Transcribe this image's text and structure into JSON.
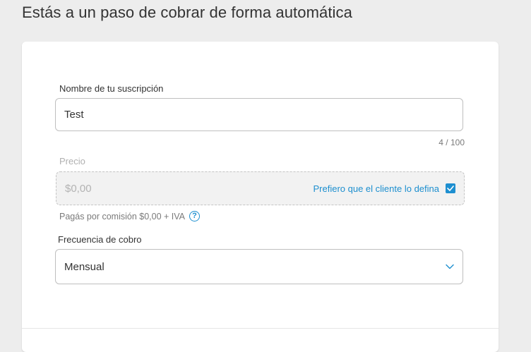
{
  "page": {
    "title": "Estás a un paso de cobrar de forma automática"
  },
  "form": {
    "name": {
      "label": "Nombre de tu suscripción",
      "value": "Test",
      "counter": "4 / 100"
    },
    "price": {
      "label": "Precio",
      "placeholder": "$0,00",
      "prefer_label": "Prefiero que el cliente lo defina",
      "prefer_checked": true,
      "commission_text": "Pagás por comisión $0,00 + IVA",
      "help_icon": "?"
    },
    "frequency": {
      "label": "Frecuencia de cobro",
      "selected": "Mensual"
    }
  },
  "colors": {
    "accent": "#1d8fcf",
    "background": "#ededed",
    "card": "#ffffff"
  }
}
